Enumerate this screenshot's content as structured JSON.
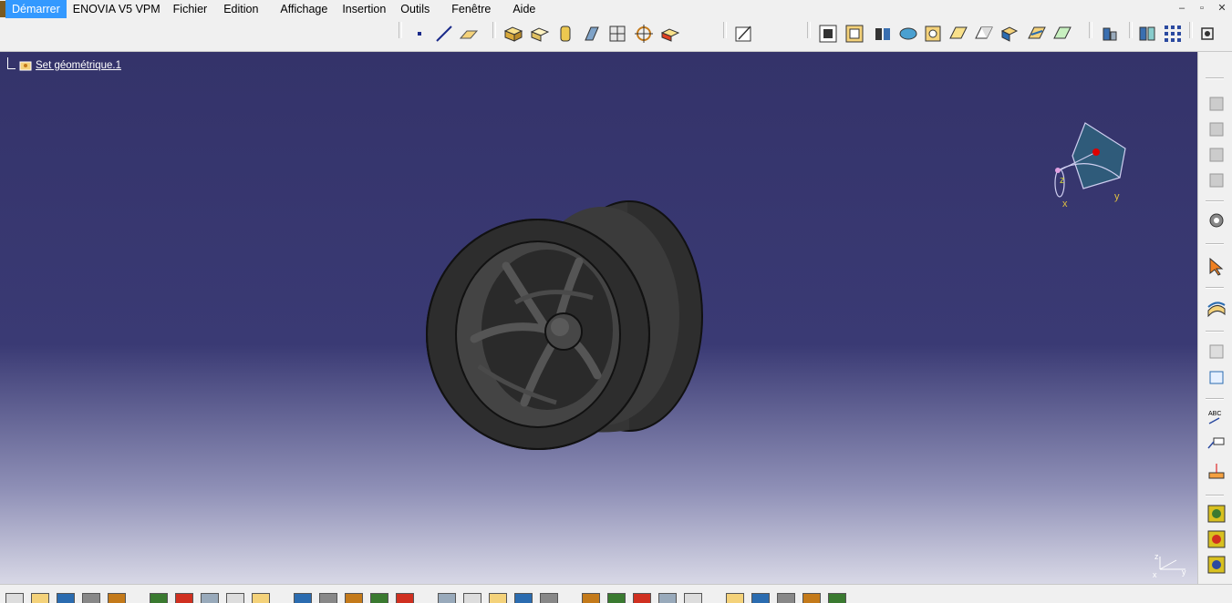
{
  "menubar": {
    "items": [
      "Démarrer",
      "ENOVIA V5 VPM",
      "Fichier",
      "Edition",
      "Affichage",
      "Insertion",
      "Outils",
      "Fenêtre",
      "Aide"
    ],
    "active_index": 0
  },
  "window_controls": {
    "minimize": "–",
    "restore": "▫",
    "close": "✕"
  },
  "tree": {
    "node_label": "Set géométrique.1",
    "node_icon": "geometric-set-icon"
  },
  "compass": {
    "axis_x": "x",
    "axis_y": "y",
    "axis_z": "z"
  },
  "mini_axis": {
    "axis_x": "x",
    "axis_y": "y",
    "axis_z": "z"
  },
  "colors": {
    "viewport_top": "#34336a",
    "viewport_bottom": "#d8d8e6",
    "part_color": "#3a3a3a",
    "menu_highlight": "#3399ff"
  },
  "toolbar_icons": {
    "top": [
      "point-icon",
      "line-icon",
      "plane-icon",
      "pad-icon",
      "pocket-icon",
      "shaft-icon",
      "groove-icon",
      "hole-icon",
      "rib-icon",
      "box-icon",
      "sketch-icon",
      "view-fit-icon",
      "view-normal-icon",
      "render-shading-icon",
      "render-edges-icon",
      "render-wire-icon",
      "view-iso-icon",
      "view-front-icon",
      "view-top-icon",
      "view-right-icon",
      "view-custom-icon",
      "hide-show-icon",
      "swap-space-icon",
      "grid-icon",
      "snap-icon"
    ],
    "right": [
      "assembly-1-icon",
      "assembly-2-icon",
      "assembly-3-icon",
      "assembly-4-icon",
      "gear-icon",
      "select-arrow-icon",
      "surface-icon",
      "constraint-icon",
      "measure-icon",
      "text-abc-icon",
      "annotation-icon",
      "dimension-icon",
      "catalog-1-icon",
      "catalog-2-icon",
      "catalog-3-icon"
    ],
    "bottom": [
      "new-icon",
      "open-icon",
      "save-icon",
      "print-icon",
      "cut-icon",
      "copy-icon",
      "paste-icon",
      "undo-icon",
      "redo-icon",
      "whats-this-icon",
      "refresh-icon",
      "search-icon",
      "measure-icon",
      "bom-icon",
      "fit-all-icon",
      "pan-icon",
      "rotate-icon",
      "zoom-in-icon",
      "zoom-out-icon",
      "normal-view-icon",
      "multi-view-icon",
      "views-icon",
      "shading-icon",
      "hide-icon",
      "swap-icon",
      "resize-icon",
      "clash-icon",
      "sectioning-icon",
      "distance-icon",
      "scale-icon"
    ]
  }
}
